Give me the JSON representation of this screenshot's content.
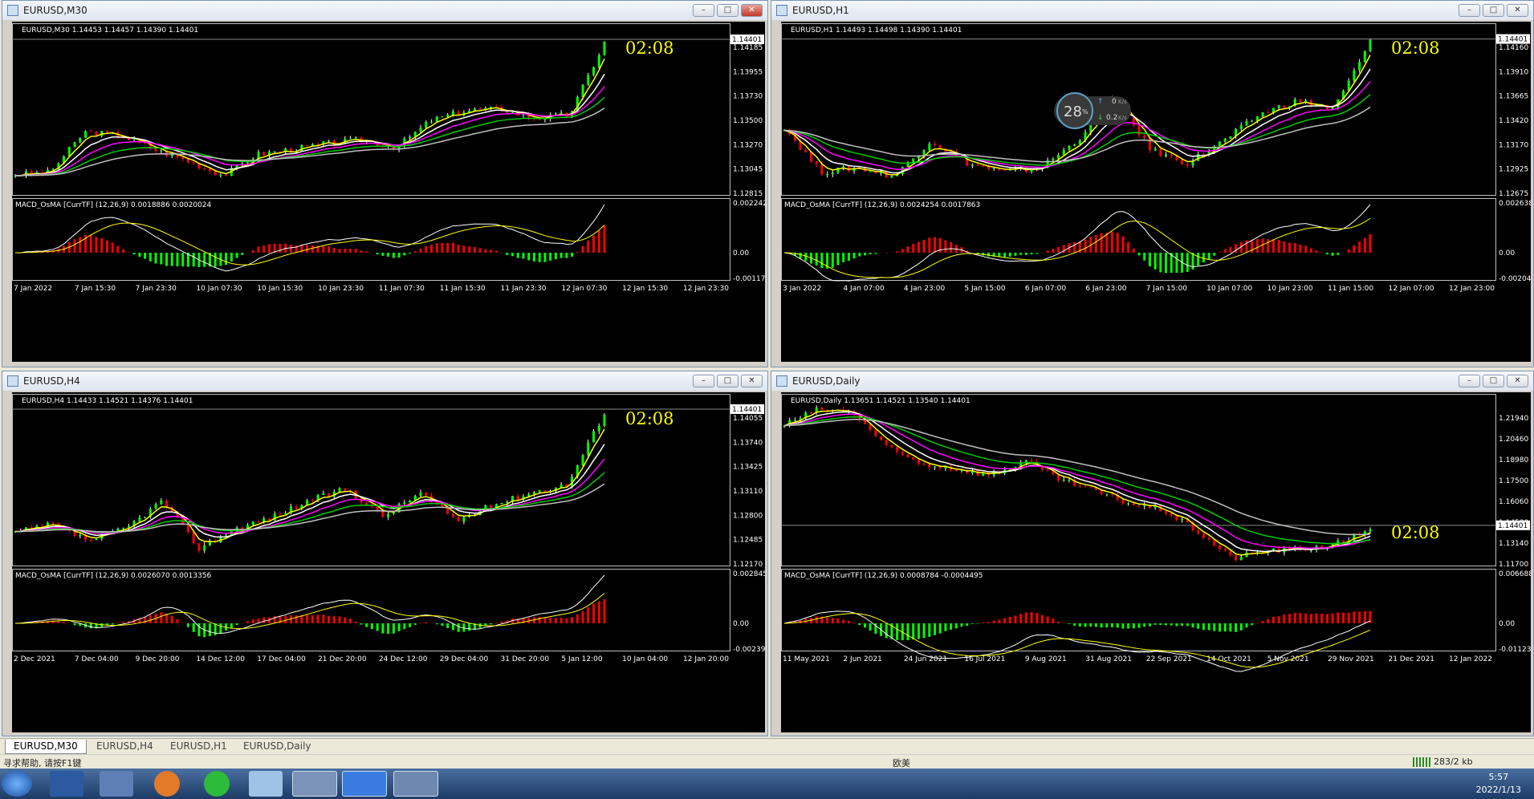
{
  "timer": "02:08",
  "windows": [
    {
      "title": "EURUSD,M30",
      "info": "EURUSD,M30  1.14453 1.14457 1.14390 1.14401",
      "price_tag": "1.14401",
      "yticks": [
        "1.14185",
        "1.13955",
        "1.13730",
        "1.13500",
        "1.13270",
        "1.13045",
        "1.12815"
      ],
      "macd_label": "MACD_OsMA [CurrTF] (12,26,9) 0.0018886 0.0020024",
      "macd_ticks": [
        "0.0022428",
        "0.00",
        "-0.001175"
      ],
      "xticks": [
        "7 Jan 2022",
        "7 Jan 15:30",
        "7 Jan 23:30",
        "10 Jan 07:30",
        "10 Jan 15:30",
        "10 Jan 23:30",
        "11 Jan 07:30",
        "11 Jan 15:30",
        "11 Jan 23:30",
        "12 Jan 07:30",
        "12 Jan 15:30",
        "12 Jan 23:30"
      ]
    },
    {
      "title": "EURUSD,H1",
      "info": "EURUSD,H1  1.14493 1.14498 1.14390 1.14401",
      "price_tag": "1.14401",
      "yticks": [
        "1.14160",
        "1.13910",
        "1.13665",
        "1.13420",
        "1.13170",
        "1.12925",
        "1.12675"
      ],
      "macd_label": "MACD_OsMA [CurrTF] (12,26,9) 0.0024254 0.0017863",
      "macd_ticks": [
        "0.0026385",
        "0.00",
        "-0.002047"
      ],
      "xticks": [
        "3 Jan 2022",
        "4 Jan 07:00",
        "4 Jan 23:00",
        "5 Jan 15:00",
        "6 Jan 07:00",
        "6 Jan 23:00",
        "7 Jan 15:00",
        "10 Jan 07:00",
        "10 Jan 23:00",
        "11 Jan 15:00",
        "12 Jan 07:00",
        "12 Jan 23:00"
      ]
    },
    {
      "title": "EURUSD,H4",
      "info": "EURUSD,H4  1.14433 1.14521 1.14376 1.14401",
      "price_tag": "1.14401",
      "yticks": [
        "1.14055",
        "1.13740",
        "1.13425",
        "1.13110",
        "1.12800",
        "1.12485",
        "1.12170"
      ],
      "macd_label": "MACD_OsMA [CurrTF] (12,26,9) 0.0026070 0.0013356",
      "macd_ticks": [
        "0.0028454",
        "0.00",
        "-0.002399"
      ],
      "xticks": [
        "2 Dec 2021",
        "7 Dec 04:00",
        "9 Dec 20:00",
        "14 Dec 12:00",
        "17 Dec 04:00",
        "21 Dec 20:00",
        "24 Dec 12:00",
        "29 Dec 04:00",
        "31 Dec 20:00",
        "5 Jan 12:00",
        "10 Jan 04:00",
        "12 Jan 20:00"
      ]
    },
    {
      "title": "EURUSD,Daily",
      "info": "EURUSD,Daily  1.13651 1.14521 1.13540 1.14401",
      "price_tag": "1.14401",
      "yticks": [
        "1.21940",
        "1.20460",
        "1.18980",
        "1.17500",
        "1.16060",
        "1.14580",
        "1.13140",
        "1.11700"
      ],
      "macd_label": "MACD_OsMA [CurrTF] (12,26,9) 0.0008784 -0.0004495",
      "macd_ticks": [
        "0.0066888",
        "0.00",
        "-0.011232"
      ],
      "xticks": [
        "11 May 2021",
        "2 Jun 2021",
        "24 Jun 2021",
        "16 Jul 2021",
        "9 Aug 2021",
        "31 Aug 2021",
        "22 Sep 2021",
        "14 Oct 2021",
        "5 Nov 2021",
        "29 Nov 2021",
        "21 Dec 2021",
        "12 Jan 2022"
      ]
    }
  ],
  "chart_data": [
    {
      "type": "line",
      "title": "EURUSD,M30",
      "series": [
        {
          "values": [
            1.1304,
            1.1306,
            1.1348,
            1.1345,
            1.133,
            1.1318,
            1.1303,
            1.1325,
            1.133,
            1.1336,
            1.134,
            1.1332,
            1.136,
            1.137,
            1.1372,
            1.1362,
            1.1366,
            1.144
          ]
        }
      ]
    },
    {
      "type": "line",
      "title": "EURUSD,H1",
      "series": [
        {
          "values": [
            1.1345,
            1.1295,
            1.13,
            1.129,
            1.133,
            1.1305,
            1.1295,
            1.13,
            1.133,
            1.138,
            1.132,
            1.1305,
            1.133,
            1.136,
            1.1375,
            1.1365,
            1.144
          ]
        }
      ]
    },
    {
      "type": "line",
      "title": "EURUSD,H4",
      "series": [
        {
          "values": [
            1.129,
            1.13,
            1.128,
            1.1295,
            1.133,
            1.127,
            1.1295,
            1.131,
            1.133,
            1.1345,
            1.131,
            1.134,
            1.1305,
            1.1325,
            1.134,
            1.135,
            1.144
          ]
        }
      ]
    },
    {
      "type": "line",
      "title": "EURUSD,Daily",
      "series": [
        {
          "values": [
            1.21,
            1.22,
            1.218,
            1.195,
            1.185,
            1.182,
            1.178,
            1.187,
            1.175,
            1.168,
            1.16,
            1.156,
            1.142,
            1.125,
            1.13,
            1.131,
            1.134,
            1.144
          ]
        }
      ]
    }
  ],
  "overlay": {
    "percent": "28",
    "pct_sign": "%",
    "up": "0",
    "down": "0.2",
    "unit": "K/s"
  },
  "tabs": [
    "EURUSD,M30",
    "EURUSD,H4",
    "EURUSD,H1",
    "EURUSD,Daily"
  ],
  "status": {
    "help": "寻求帮助, 请按F1键",
    "profile": "欧美",
    "traffic": "283/2 kb"
  },
  "clock": {
    "time": "5:57",
    "date": "2022/1/13"
  },
  "icons": [
    "start-orb-icon",
    "desktop-icon",
    "app-icon",
    "browser-icon",
    "wechat-icon",
    "notepad-icon",
    "mt4-icon",
    "feather-icon",
    "paint-icon"
  ]
}
